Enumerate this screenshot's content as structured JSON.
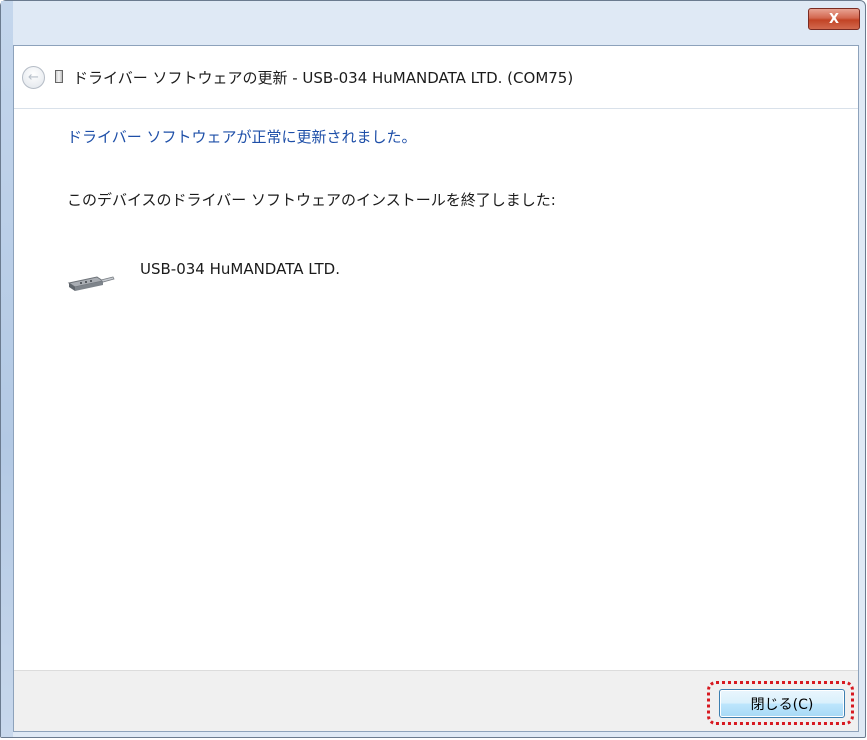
{
  "window": {
    "title": "ドライバー ソフトウェアの更新 - USB-034 HuMANDATA LTD. (COM75)",
    "close_glyph": "X"
  },
  "nav": {
    "back_icon": "back-arrow-icon",
    "back_glyph": "←"
  },
  "content": {
    "heading": "ドライバー ソフトウェアが正常に更新されました。",
    "description": "このデバイスのドライバー ソフトウェアのインストールを終了しました:",
    "device_icon": "serial-port-icon",
    "device_name": "USB-034 HuMANDATA LTD."
  },
  "footer": {
    "close_button_label": "閉じる(C)"
  },
  "colors": {
    "heading": "#1e4fa8",
    "highlight": "#d71920",
    "window_frame": "#dfe9f5",
    "close_button": "#c24325"
  }
}
